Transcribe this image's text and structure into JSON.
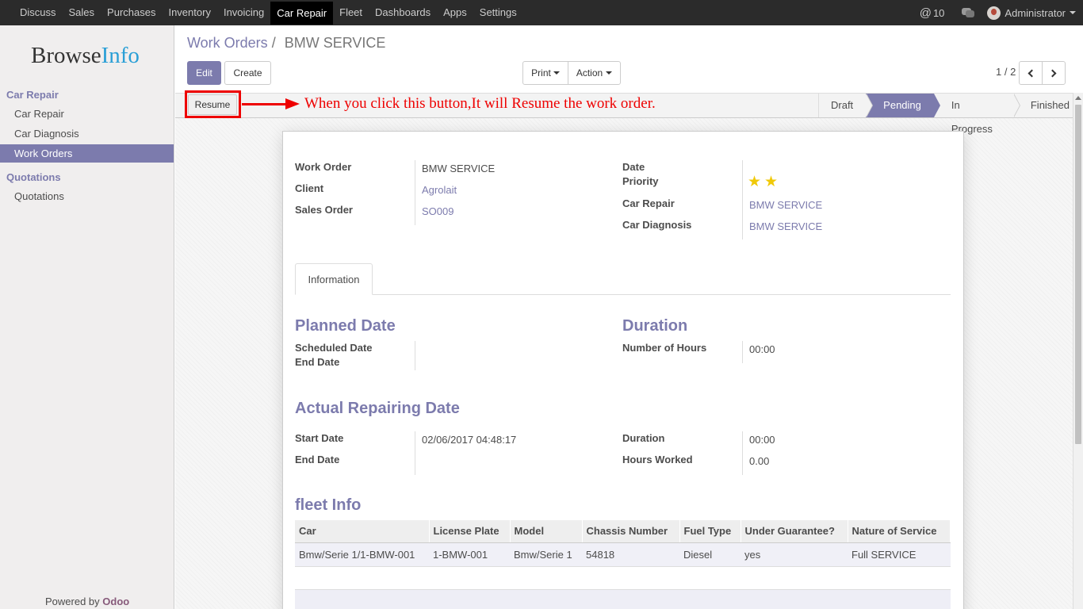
{
  "topnav": {
    "items": [
      "Discuss",
      "Sales",
      "Purchases",
      "Inventory",
      "Invoicing",
      "Car Repair",
      "Fleet",
      "Dashboards",
      "Apps",
      "Settings"
    ],
    "active_index": 5,
    "mentions_count": "10",
    "user": "Administrator"
  },
  "sidebar": {
    "logo_a": "Browse",
    "logo_b": "Info",
    "section1": "Car Repair",
    "items1": [
      "Car Repair",
      "Car Diagnosis",
      "Work Orders"
    ],
    "section2": "Quotations",
    "items2": [
      "Quotations"
    ],
    "powered_prefix": "Powered by ",
    "powered_brand": "Odoo"
  },
  "header": {
    "breadcrumb_link": "Work Orders",
    "breadcrumb_sep": "/",
    "breadcrumb_current": "BMW SERVICE",
    "edit_label": "Edit",
    "create_label": "Create",
    "print_label": "Print",
    "action_label": "Action",
    "pager": "1 / 2"
  },
  "statusbar": {
    "resume_label": "Resume",
    "annotation": "When you click this button,It will Resume the work order.",
    "stages": [
      "Draft",
      "Pending",
      "In Progress",
      "Finished"
    ],
    "active_stage": "Pending"
  },
  "form": {
    "work_order_label": "Work Order",
    "work_order_value": "BMW SERVICE",
    "client_label": "Client",
    "client_value": "Agrolait",
    "sales_order_label": "Sales Order",
    "sales_order_value": "SO009",
    "date_label": "Date",
    "priority_label": "Priority",
    "priority_stars": 2,
    "car_repair_label": "Car Repair",
    "car_repair_value": "BMW SERVICE",
    "car_diagnosis_label": "Car Diagnosis",
    "car_diagnosis_value": "BMW SERVICE",
    "tab_information": "Information",
    "planned_date_title": "Planned Date",
    "scheduled_date_label": "Scheduled Date",
    "end_date_label": "End Date",
    "duration_title": "Duration",
    "number_of_hours_label": "Number of Hours",
    "number_of_hours_value": "00:00",
    "actual_title": "Actual Repairing Date",
    "start_date_label": "Start Date",
    "start_date_value": "02/06/2017 04:48:17",
    "actual_end_date_label": "End Date",
    "duration_label": "Duration",
    "duration_value": "00:00",
    "hours_worked_label": "Hours Worked",
    "hours_worked_value": "0.00",
    "fleet_title": "fleet Info"
  },
  "fleet_table": {
    "headers": [
      "Car",
      "License Plate",
      "Model",
      "Chassis Number",
      "Fuel Type",
      "Under Guarantee?",
      "Nature of Service"
    ],
    "rows": [
      [
        "Bmw/Serie 1/1-BMW-001",
        "1-BMW-001",
        "Bmw/Serie 1",
        "54818",
        "Diesel",
        "yes",
        "Full SERVICE"
      ]
    ]
  },
  "colors": {
    "accent": "#7c7bad",
    "annotation": "#ee0000",
    "star": "#f0c908"
  }
}
